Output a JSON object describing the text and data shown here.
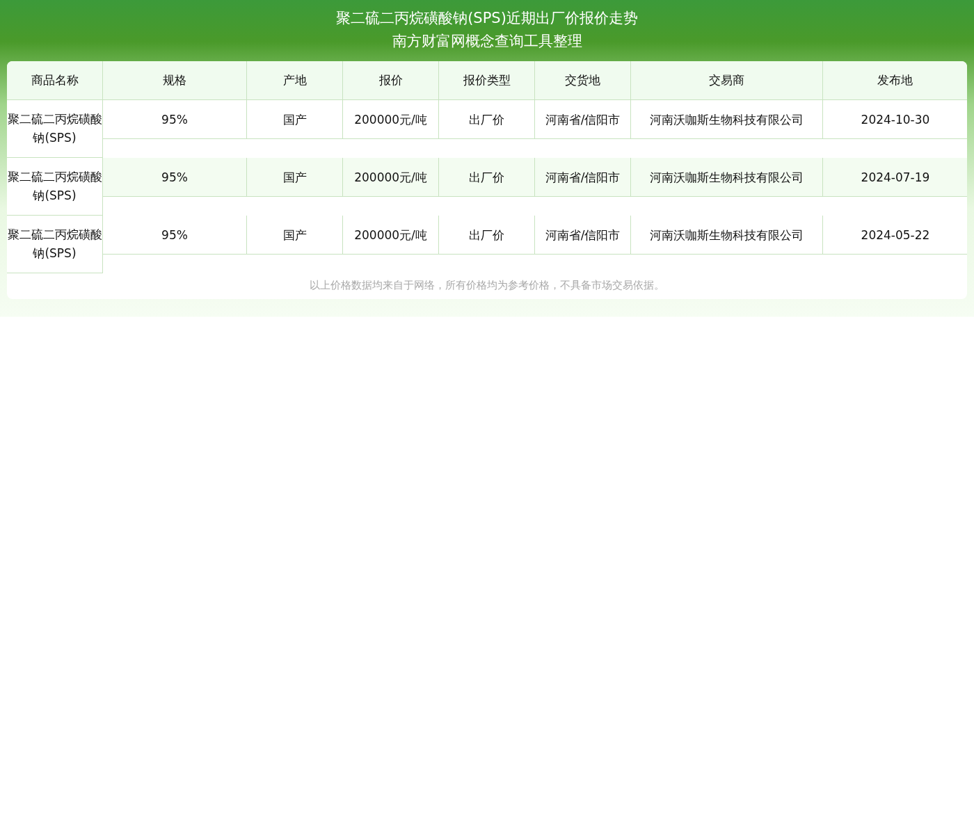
{
  "title": [
    "聚二硫二丙烷磺酸钠(SPS)近期出厂价报价走势",
    "南方财富网概念查询工具整理"
  ],
  "table": {
    "columns": [
      "商品名称",
      "规格",
      "产地",
      "报价",
      "报价类型",
      "交货地",
      "交易商",
      "发布地"
    ],
    "rows": [
      {
        "cells": [
          "聚二硫二丙烷磺酸钠(SPS)",
          "95%",
          "国产",
          "200000元/吨",
          "出厂价",
          "河南省/信阳市",
          "河南沃咖斯生物科技有限公司",
          "2024-10-30"
        ]
      },
      {
        "cells": [
          "聚二硫二丙烷磺酸钠(SPS)",
          "95%",
          "国产",
          "200000元/吨",
          "出厂价",
          "河南省/信阳市",
          "河南沃咖斯生物科技有限公司",
          "2024-07-19"
        ]
      },
      {
        "cells": [
          "聚二硫二丙烷磺酸钠(SPS)",
          "95%",
          "国产",
          "200000元/吨",
          "出厂价",
          "河南省/信阳市",
          "河南沃咖斯生物科技有限公司",
          "2024-05-22"
        ]
      }
    ]
  },
  "note": "以上价格数据均来自于网络，所有价格均为参考价格，不具备市场交易依据。"
}
